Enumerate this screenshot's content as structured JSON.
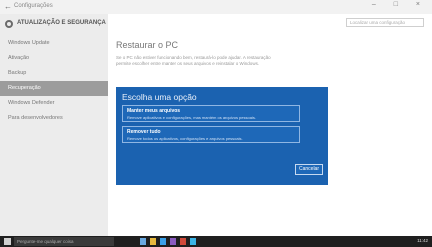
{
  "window": {
    "title": "Configurações",
    "controls": "– □ ×"
  },
  "sidebar": {
    "title": "ATUALIZAÇÃO E SEGURANÇA",
    "items": [
      {
        "label": "Windows Update"
      },
      {
        "label": "Ativação"
      },
      {
        "label": "Backup"
      },
      {
        "label": "Recuperação"
      },
      {
        "label": "Windows Defender"
      },
      {
        "label": "Para desenvolvedores"
      }
    ],
    "active_index": 3
  },
  "search": {
    "placeholder": "Localizar uma configuração"
  },
  "main": {
    "page_title": "Restaurar o PC",
    "description": "Se o PC não estiver funcionando bem, restaurá-lo pode ajudar. A restauração permite escolher entre manter os seus arquivos e reinstalar o Windows."
  },
  "dialog": {
    "title": "Escolha uma opção",
    "options": [
      {
        "title": "Manter meus arquivos",
        "desc": "Remove aplicativos e configurações, mas mantém os arquivos pessoais."
      },
      {
        "title": "Remover tudo",
        "desc": "Remove todos os aplicativos, configurações e arquivos pessoais."
      }
    ],
    "cancel_label": "Cancelar"
  },
  "taskbar": {
    "search_placeholder": "Pergunte-me qualquer coisa",
    "app_colors": [
      "#6aa9e0",
      "#e8b93e",
      "#3aa0e8",
      "#8a5cc0",
      "#d04a3a",
      "#3bb4e6"
    ],
    "tray_text": "11:42"
  }
}
